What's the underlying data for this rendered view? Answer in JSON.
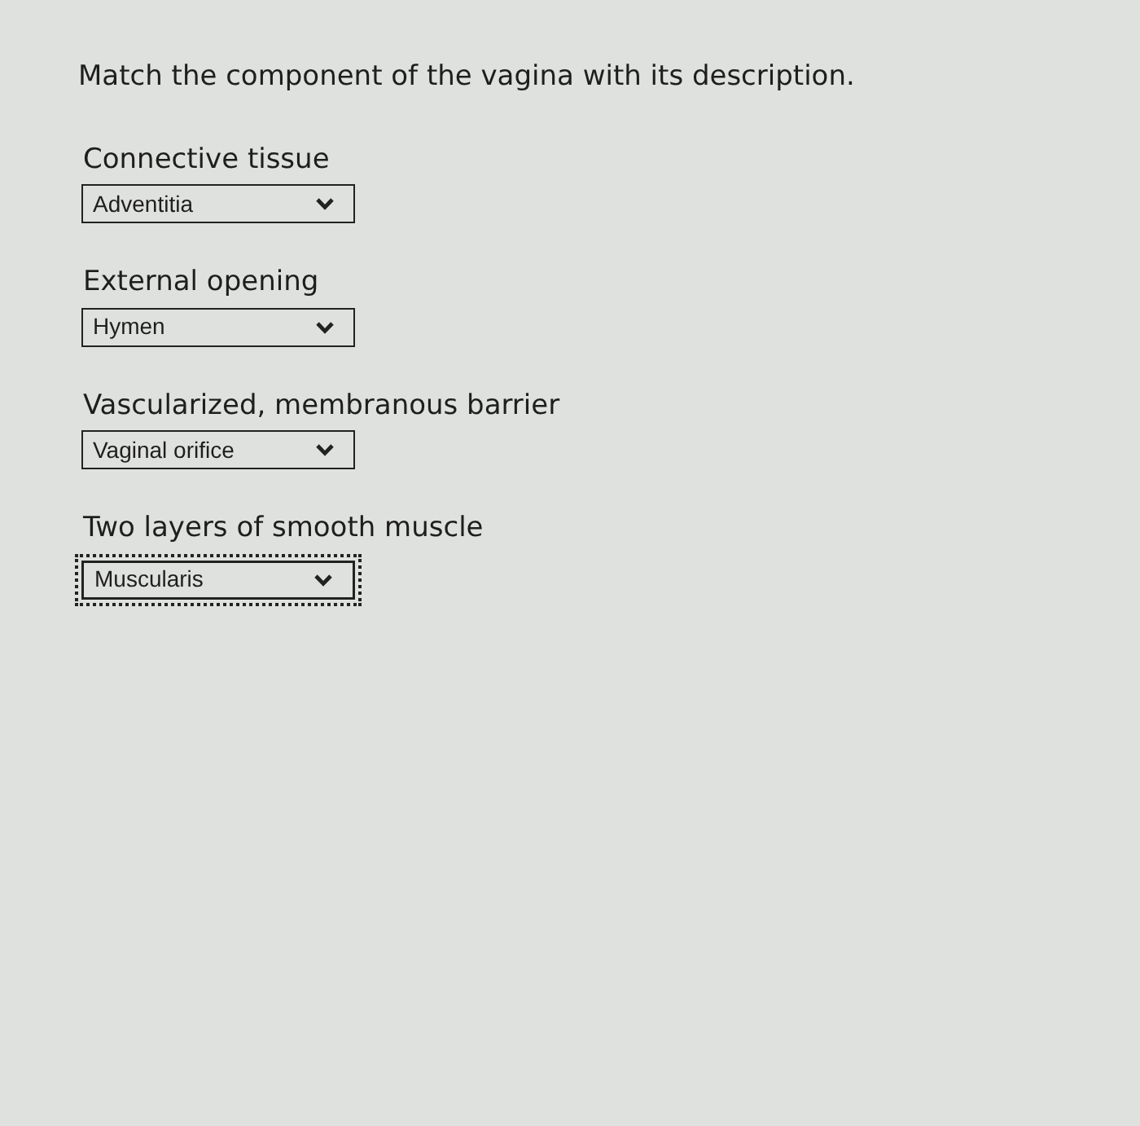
{
  "question": {
    "text": "Match the component of the vagina with its description."
  },
  "items": [
    {
      "label": "Connective tissue",
      "answer": "Adventitia",
      "focused": false
    },
    {
      "label": "External opening",
      "answer": "Hymen",
      "focused": false
    },
    {
      "label": "Vascularized, membranous barrier",
      "answer": "Vaginal orifice",
      "focused": false
    },
    {
      "label": "Two layers of smooth muscle",
      "answer": "Muscularis",
      "focused": true
    }
  ]
}
